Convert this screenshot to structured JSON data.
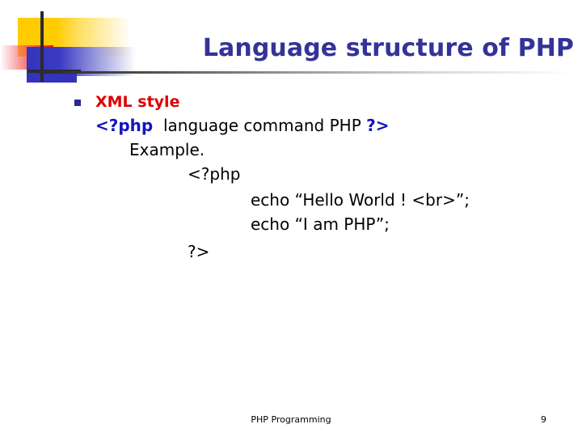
{
  "slide": {
    "title": "Language structure of PHP",
    "bullet": {
      "marker": "square-bullet",
      "label": "XML style"
    },
    "syntax_line": {
      "open_tag": "<?php",
      "middle": "language command PHP",
      "close_tag": "?>"
    },
    "example": {
      "label": "Example.",
      "code_lines": [
        "<?php",
        "echo “Hello  World ! <br>”;",
        "echo “I am  PHP”;",
        "?>"
      ]
    }
  },
  "footer": {
    "text": "PHP Programming",
    "page_number": "9"
  },
  "colors": {
    "title": "#333399",
    "accent_red": "#DD0000",
    "accent_blue": "#1414BE",
    "bullet": "#2A2A8C",
    "deco_yellow": "#FFCC00",
    "deco_red": "#EE1111",
    "deco_blue": "#3333BB",
    "rule": "#2B2B2B",
    "background": "#FFFFFF"
  }
}
